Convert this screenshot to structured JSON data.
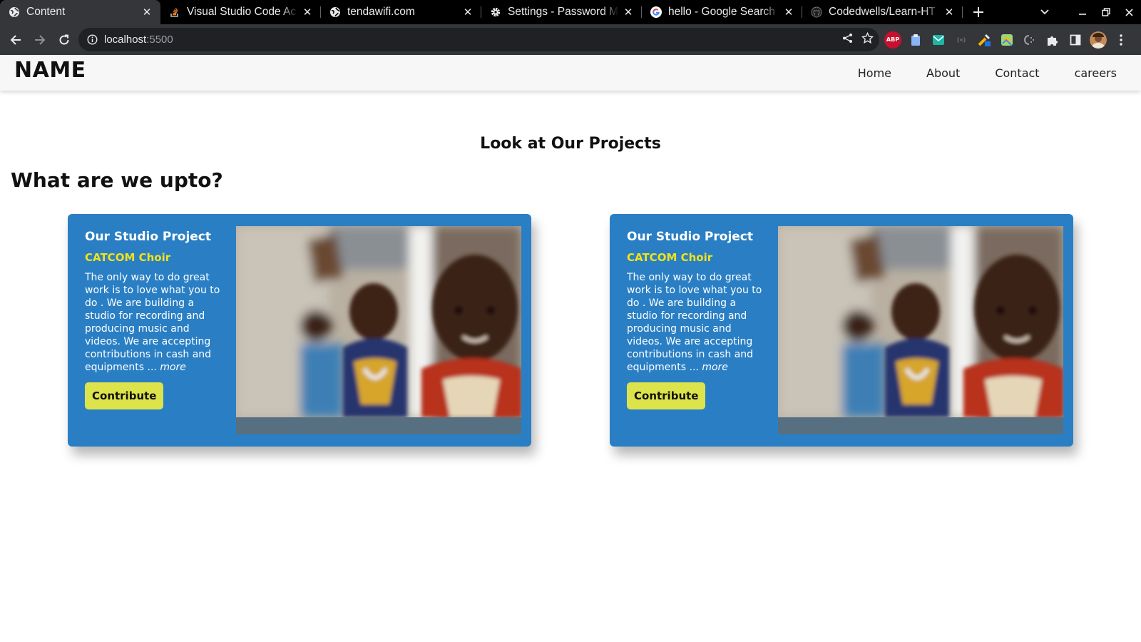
{
  "browser": {
    "tabs": [
      {
        "title": "Content",
        "icon": "globe-icon",
        "active": true
      },
      {
        "title": "Visual Studio Code Ac",
        "icon": "stackoverflow-icon",
        "active": false
      },
      {
        "title": "tendawifi.com",
        "icon": "globe-icon",
        "active": false
      },
      {
        "title": "Settings - Password M",
        "icon": "gear-icon",
        "active": false
      },
      {
        "title": "hello - Google Search",
        "icon": "google-icon",
        "active": false
      },
      {
        "title": "Codedwells/Learn-HT",
        "icon": "github-icon",
        "active": false
      }
    ],
    "url_host": "localhost",
    "url_port": ":5500",
    "extensions": [
      "abp-icon",
      "clipboard-icon",
      "email-icon",
      "broadcast-icon",
      "eyedropper-icon",
      "map-icon",
      "code-icon",
      "puzzle-icon"
    ],
    "ext_labels": {
      "abp": "ABP"
    }
  },
  "site": {
    "brand": "NAME",
    "nav": [
      "Home",
      "About",
      "Contact",
      "careers"
    ]
  },
  "main": {
    "section_title": "Look at Our Projects",
    "heading": "What are we upto?",
    "cards": [
      {
        "title": "Our Studio Project",
        "subtitle": "CATCOM Choir",
        "body": "The only way to do great work is to love what you to do . We are building a studio for recording and producing music and videos. We are accepting contributions in cash and equipments ...",
        "more": "more",
        "button": "Contribute"
      },
      {
        "title": "Our Studio Project",
        "subtitle": "CATCOM Choir",
        "body": "The only way to do great work is to love what you to do . We are building a studio for recording and producing music and videos. We are accepting contributions in cash and equipments ...",
        "more": "more",
        "button": "Contribute"
      }
    ]
  },
  "colors": {
    "card_bg": "#2a7fc4",
    "card_subtitle": "#f2e21a",
    "button_bg": "#dde34a",
    "nav_bg": "#f7f7f7",
    "chrome_bg": "#35363a"
  }
}
